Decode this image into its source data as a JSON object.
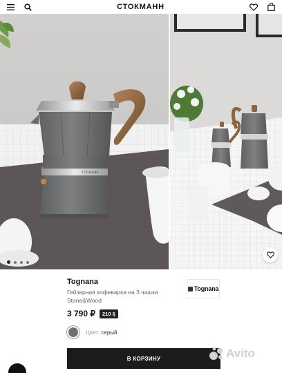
{
  "header": {
    "logo": "СТОКМАНН",
    "icons": [
      "menu-icon",
      "search-icon",
      "heart-icon",
      "shopping-bag-icon"
    ]
  },
  "gallery": {
    "dots_total": 4,
    "active_dot": 1
  },
  "product": {
    "brand": "Tognana",
    "title": "Гейзерная кофеварка на 3 чашки Stone&Wood",
    "brand_logo": "Tognana",
    "price": "3 790 ₽",
    "bonus": "210",
    "color_label": "Цвет:",
    "color_value": "серый",
    "swatch_color": "#707070",
    "cart_button": "В КОРЗИНУ"
  },
  "watermark": "Avito"
}
